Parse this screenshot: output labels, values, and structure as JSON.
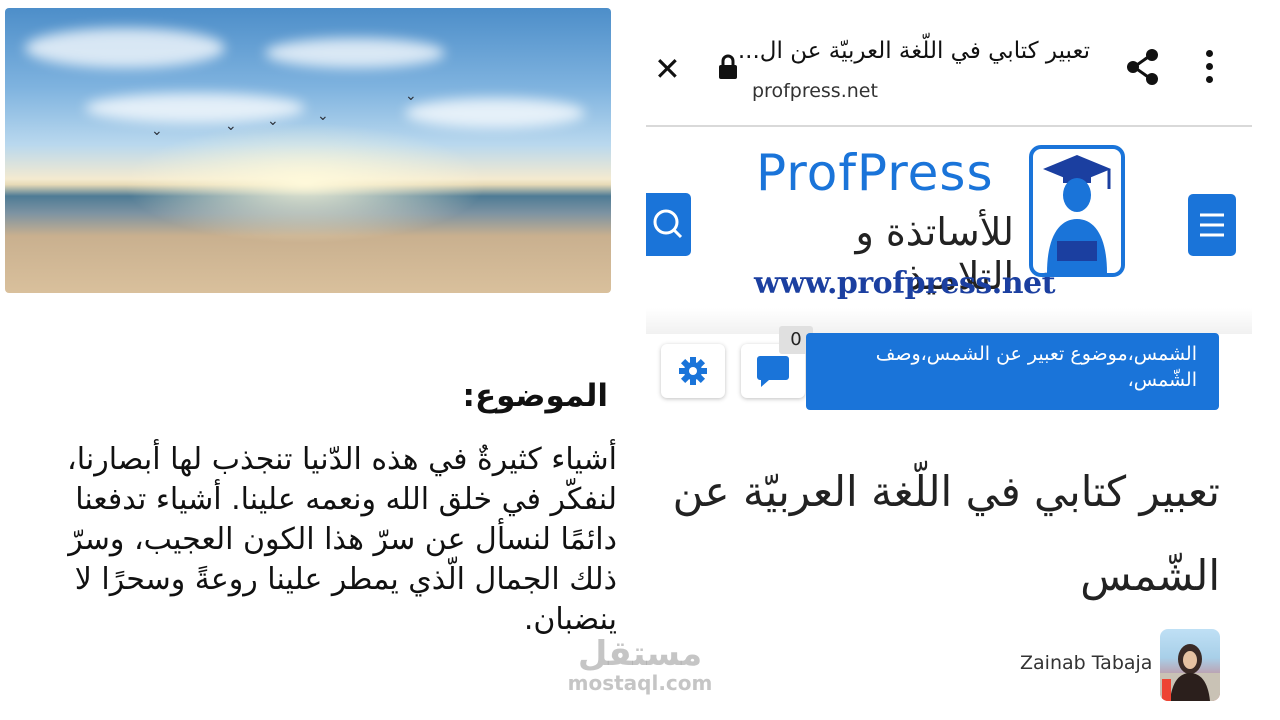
{
  "browser": {
    "page_title": "تعبير كتابي في اللّغة العربيّة عن ال...",
    "url": "profpress.net",
    "close_glyph": "✕"
  },
  "site": {
    "logo_name": "ProfPress",
    "logo_tagline": "للأساتذة و التلاميذ",
    "logo_url": "www.profpress.net"
  },
  "post": {
    "tags": "الشمس،موضوع تعبير عن الشمس،وصف الشّمس،",
    "comment_count": "0",
    "title": "تعبير كتابي في اللّغة العربيّة عن الشّمس",
    "author": "Zainab Tabaja"
  },
  "excerpt": {
    "label": "الموضوع:",
    "body": "أشياء كثيرةٌ في هذه الدّنيا تنجذب لها أبصارنا، لنفكّر في خلق الله ونعمه علينا. أشياء تدفعنا دائمًا لنسأل عن سرّ هذا الكون العجيب، وسرّ ذلك الجمال الّذي يمطر علينا روعةً وسحرًا لا ينضبان."
  },
  "watermark": {
    "arabic": "مستقل",
    "latin": "mostaql.com"
  },
  "colors": {
    "accent": "#1a74d9",
    "logo_url": "#1b3fa0"
  },
  "icons": [
    "close-icon",
    "lock-icon",
    "share-icon",
    "more-vert-icon",
    "search-icon",
    "menu-icon",
    "gear-icon",
    "comment-icon"
  ]
}
